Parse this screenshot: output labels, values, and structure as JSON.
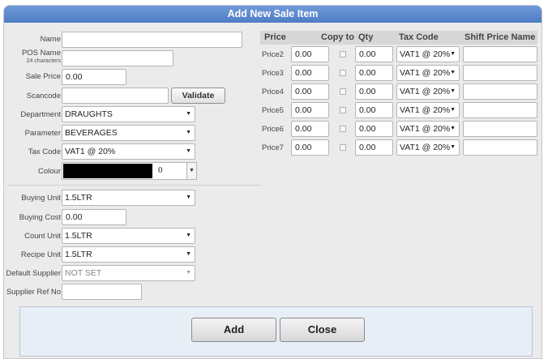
{
  "dialog": {
    "title": "Add New Sale Item"
  },
  "fields": {
    "name": {
      "label": "Name",
      "value": ""
    },
    "pos_name": {
      "label": "POS Name",
      "sublabel": "24 characters",
      "value": ""
    },
    "sale_price": {
      "label": "Sale Price",
      "value": "0.00"
    },
    "scancode": {
      "label": "Scancode",
      "value": "",
      "validate_label": "Validate"
    },
    "department": {
      "label": "Department",
      "value": "DRAUGHTS"
    },
    "parameter": {
      "label": "Parameter",
      "value": "BEVERAGES"
    },
    "tax_code": {
      "label": "Tax Code",
      "value": "VAT1 @ 20%"
    },
    "colour": {
      "label": "Colour",
      "value": "0",
      "swatch": "#000000"
    },
    "buying_unit": {
      "label": "Buying Unit",
      "value": "1.5LTR"
    },
    "buying_cost": {
      "label": "Buying Cost",
      "value": "0.00"
    },
    "count_unit": {
      "label": "Count Unit",
      "value": "1.5LTR"
    },
    "recipe_unit": {
      "label": "Recipe Unit",
      "value": "1.5LTR"
    },
    "default_supplier": {
      "label": "Default Supplier",
      "value": "NOT SET"
    },
    "supplier_ref": {
      "label": "Supplier Ref No",
      "value": ""
    }
  },
  "price_table": {
    "headers": {
      "price": "Price",
      "copy_to": "Copy to",
      "qty": "Qty",
      "tax_code": "Tax Code",
      "shift_price_name": "Shift Price Name"
    },
    "rows": [
      {
        "label": "Price2",
        "price": "0.00",
        "qty": "0.00",
        "tax": "VAT1 @ 20%",
        "shift_name": ""
      },
      {
        "label": "Price3",
        "price": "0.00",
        "qty": "0.00",
        "tax": "VAT1 @ 20%",
        "shift_name": ""
      },
      {
        "label": "Price4",
        "price": "0.00",
        "qty": "0.00",
        "tax": "VAT1 @ 20%",
        "shift_name": ""
      },
      {
        "label": "Price5",
        "price": "0.00",
        "qty": "0.00",
        "tax": "VAT1 @ 20%",
        "shift_name": ""
      },
      {
        "label": "Price6",
        "price": "0.00",
        "qty": "0.00",
        "tax": "VAT1 @ 20%",
        "shift_name": ""
      },
      {
        "label": "Price7",
        "price": "0.00",
        "qty": "0.00",
        "tax": "VAT1 @ 20%",
        "shift_name": ""
      }
    ]
  },
  "footer": {
    "add_label": "Add",
    "close_label": "Close"
  },
  "icons": {
    "dropdown": "chevron-down-icon",
    "checkbox": "checkbox-icon"
  },
  "colors": {
    "title_bar": "#5b87cc",
    "dialog_bg": "#ebebeb",
    "footer_bg": "#e7eef6"
  }
}
